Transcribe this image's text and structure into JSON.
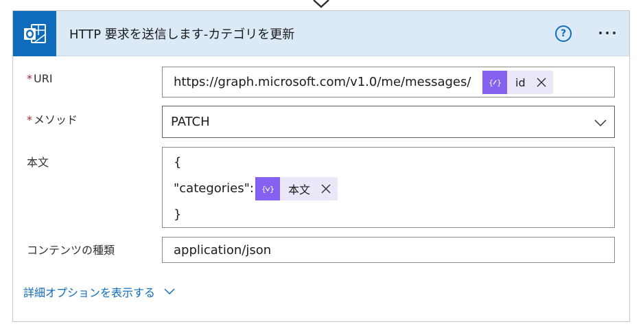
{
  "header": {
    "title": "HTTP 要求を送信します-カテゴリを更新",
    "help_symbol": "?",
    "app_icon": "outlook-icon",
    "accent_color": "#0f6cbd",
    "header_bg": "#dce9f7"
  },
  "fields": {
    "uri": {
      "required_mark": "*",
      "label": "URI",
      "value_text": "https://graph.microsoft.com/v1.0/me/messages/",
      "token": {
        "label": "id",
        "icon": "expression-icon"
      }
    },
    "method": {
      "required_mark": "*",
      "label": "メソッド",
      "value": "PATCH"
    },
    "body": {
      "label": "本文",
      "lines": [
        "{",
        "\"categories\":",
        "}"
      ],
      "token": {
        "label": "本文",
        "icon": "variable-icon"
      }
    },
    "content_type": {
      "label": "コンテンツの種類",
      "value": "application/json"
    }
  },
  "advanced": {
    "label": "詳細オプションを表示する"
  },
  "token_colors": {
    "icon_bg": "#8461f0",
    "chip_bg": "#ece6f9"
  }
}
